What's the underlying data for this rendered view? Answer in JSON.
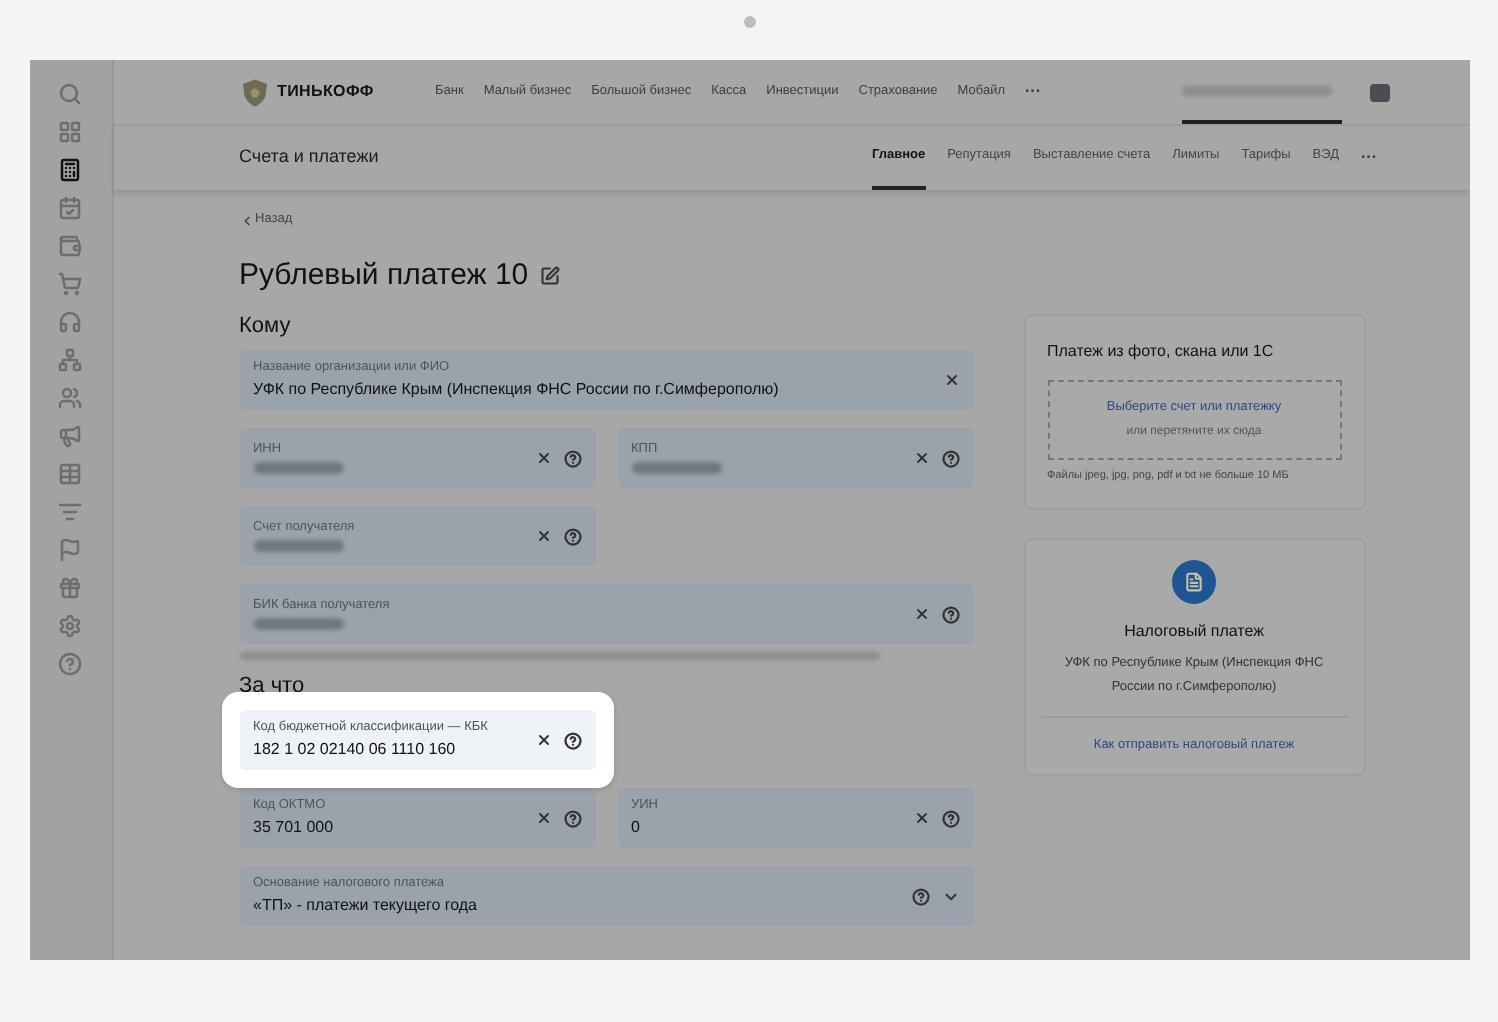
{
  "sidebar": {
    "items": [
      {
        "selected": false
      },
      {
        "selected": false
      },
      {
        "selected": true
      },
      {
        "selected": false
      },
      {
        "selected": false
      },
      {
        "selected": false
      },
      {
        "selected": false
      },
      {
        "selected": false
      },
      {
        "selected": false
      },
      {
        "selected": false
      },
      {
        "selected": false
      },
      {
        "selected": false
      },
      {
        "selected": false
      },
      {
        "selected": false
      },
      {
        "selected": false
      },
      {
        "selected": false
      }
    ]
  },
  "top_nav": {
    "logo": "ТИНЬКОФФ",
    "items": [
      "Банк",
      "Малый бизнес",
      "Большой бизнес",
      "Касса",
      "Инвестиции",
      "Страхование",
      "Мобайл"
    ],
    "more": "···"
  },
  "sub_nav": {
    "title": "Счета и платежи",
    "tabs": [
      {
        "label": "Главное",
        "selected": true
      },
      {
        "label": "Репутация",
        "selected": false
      },
      {
        "label": "Выставление счета",
        "selected": false
      },
      {
        "label": "Лимиты",
        "selected": false
      },
      {
        "label": "Тарифы",
        "selected": false
      },
      {
        "label": "ВЭД",
        "selected": false
      }
    ],
    "more": "···"
  },
  "back_link": "Назад",
  "title": "Рублевый платеж 10",
  "sections": [
    {
      "title": "Кому",
      "rows": [
        [
          {
            "label": "Название организации или ФИО",
            "value": "УФК по Республике Крым (Инспекция ФНС России по г.Симферополю)",
            "blurred": false,
            "wide": true,
            "clear": true,
            "help": false,
            "dropdown": false,
            "highlighted": false
          }
        ],
        [
          {
            "label": "ИНН",
            "blurred": true,
            "wide": false,
            "clear": true,
            "help": true,
            "dropdown": false,
            "highlighted": false
          },
          {
            "label": "КПП",
            "blurred": true,
            "wide": false,
            "clear": true,
            "help": true,
            "dropdown": false,
            "highlighted": false
          }
        ],
        [
          {
            "label": "Счет получателя",
            "blurred": true,
            "wide": false,
            "clear": true,
            "help": true,
            "dropdown": false,
            "highlighted": false
          }
        ],
        [
          {
            "label": "БИК банка получателя",
            "blurred": true,
            "wide": true,
            "clear": true,
            "help": true,
            "dropdown": false,
            "highlighted": false,
            "blurred_hint": true
          }
        ]
      ]
    },
    {
      "title": "За что",
      "rows": [
        [
          {
            "label": "Код бюджетной классификации — КБК",
            "value": "182 1 02 02140 06 1110 160",
            "blurred": false,
            "wide": false,
            "clear": true,
            "help": true,
            "dropdown": false,
            "highlighted": true
          }
        ],
        [
          {
            "label": "Код ОКТМО",
            "value": "35 701 000",
            "blurred": false,
            "wide": false,
            "clear": true,
            "help": true,
            "dropdown": false,
            "highlighted": false
          },
          {
            "label": "УИН",
            "value": "0",
            "blurred": false,
            "wide": false,
            "clear": true,
            "help": true,
            "dropdown": false,
            "highlighted": false
          }
        ],
        [
          {
            "label": "Основание налогового платежа",
            "value": "«ТП» - платежи текущего года",
            "blurred": false,
            "wide": true,
            "clear": false,
            "help": true,
            "dropdown": true,
            "highlighted": false
          }
        ]
      ]
    }
  ],
  "upload_card": {
    "title": "Платеж из фото, скана или 1С",
    "link": "Выберите счет или платежку",
    "hint": "или перетяните их сюда",
    "note": "Файлы jpeg, jpg, png, pdf и txt не больше 10 МБ"
  },
  "tax_card": {
    "title": "Налоговый платеж",
    "text": "УФК по Республике Крым (Инспекция ФНС России по г.Симферополю)",
    "link": "Как отправить налоговый платеж"
  }
}
